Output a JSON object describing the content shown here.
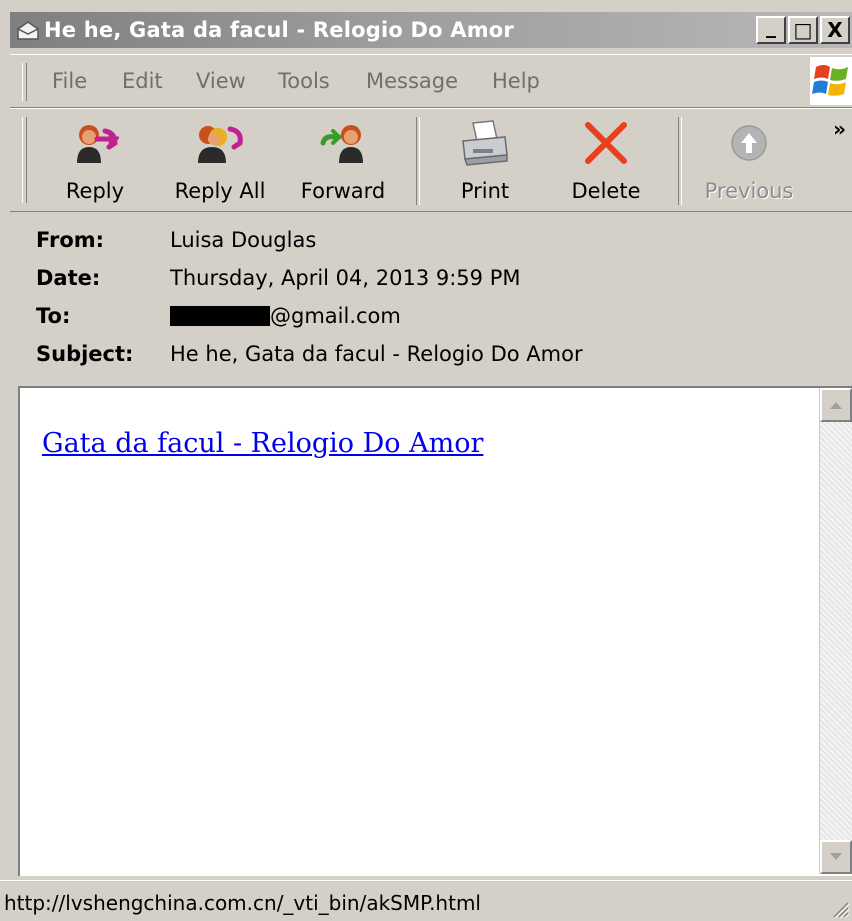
{
  "window": {
    "title": "He he,  Gata da facul - Relogio Do Amor",
    "controls": {
      "minimize": "_",
      "maximize": "□",
      "close": "X"
    }
  },
  "menu": [
    "File",
    "Edit",
    "View",
    "Tools",
    "Message",
    "Help"
  ],
  "toolbar": {
    "buttons": [
      {
        "label": "Reply",
        "icon": "reply-icon",
        "enabled": true
      },
      {
        "label": "Reply All",
        "icon": "reply-all-icon",
        "enabled": true
      },
      {
        "label": "Forward",
        "icon": "forward-icon",
        "enabled": true
      },
      {
        "label": "Print",
        "icon": "print-icon",
        "enabled": true
      },
      {
        "label": "Delete",
        "icon": "delete-icon",
        "enabled": true
      },
      {
        "label": "Previous",
        "icon": "previous-icon",
        "enabled": false
      }
    ],
    "overflow": "»"
  },
  "message": {
    "from_label": "From:",
    "from": "Luisa Douglas",
    "date_label": "Date:",
    "date": "Thursday, April 04, 2013 9:59 PM",
    "to_label": "To:",
    "to_suffix": "@gmail.com",
    "subject_label": "Subject:",
    "subject": "He he,  Gata da facul - Relogio Do Amor",
    "body_link": "Gata da facul - Relogio Do Amor"
  },
  "status": {
    "text": "http://lvshengchina.com.cn/_vti_bin/akSMP.html"
  },
  "colors": {
    "title_bar": "#9a9a9a",
    "chrome": "#d4d0c8",
    "link": "#0000ee",
    "delete_x": "#e8401c"
  }
}
